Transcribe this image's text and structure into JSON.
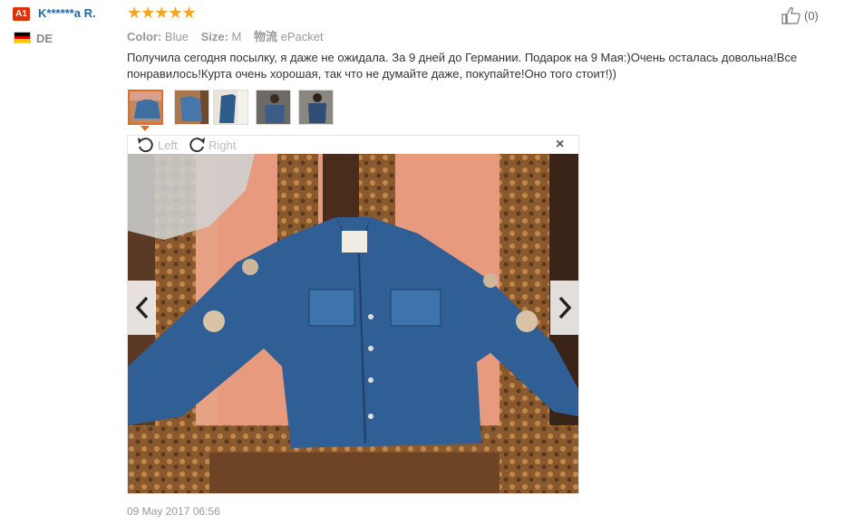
{
  "reviewer": {
    "level_badge": "A1",
    "name": "K******a R.",
    "country": "DE"
  },
  "rating": {
    "stars": 5,
    "stars_text": "★★★★★"
  },
  "helpful": {
    "count_text": "(0)"
  },
  "attributes": {
    "color_label": "Color:",
    "color_value": "Blue",
    "size_label": "Size:",
    "size_value": "M",
    "shipping_label": "物流",
    "shipping_value": "ePacket"
  },
  "review": {
    "text": "Получила сегодня посылку, я даже не ожидала. За 9 дней до Германии. Подарок на 9 Мая:)Очень осталась довольна!Все понравилось!Курта очень хорошая, так что не думайте даже, покупайте!Оно того стоит!))",
    "date": "09 May 2017 06:56"
  },
  "viewer": {
    "rotate_left_label": "Left",
    "rotate_right_label": "Right",
    "close_label": "×",
    "thumbnail_count": 5,
    "active_thumbnail": 1
  },
  "colors": {
    "badge": "#d9340c",
    "name": "#2266aa",
    "star": "#f5a623",
    "thumb_active": "#e86a1c"
  }
}
